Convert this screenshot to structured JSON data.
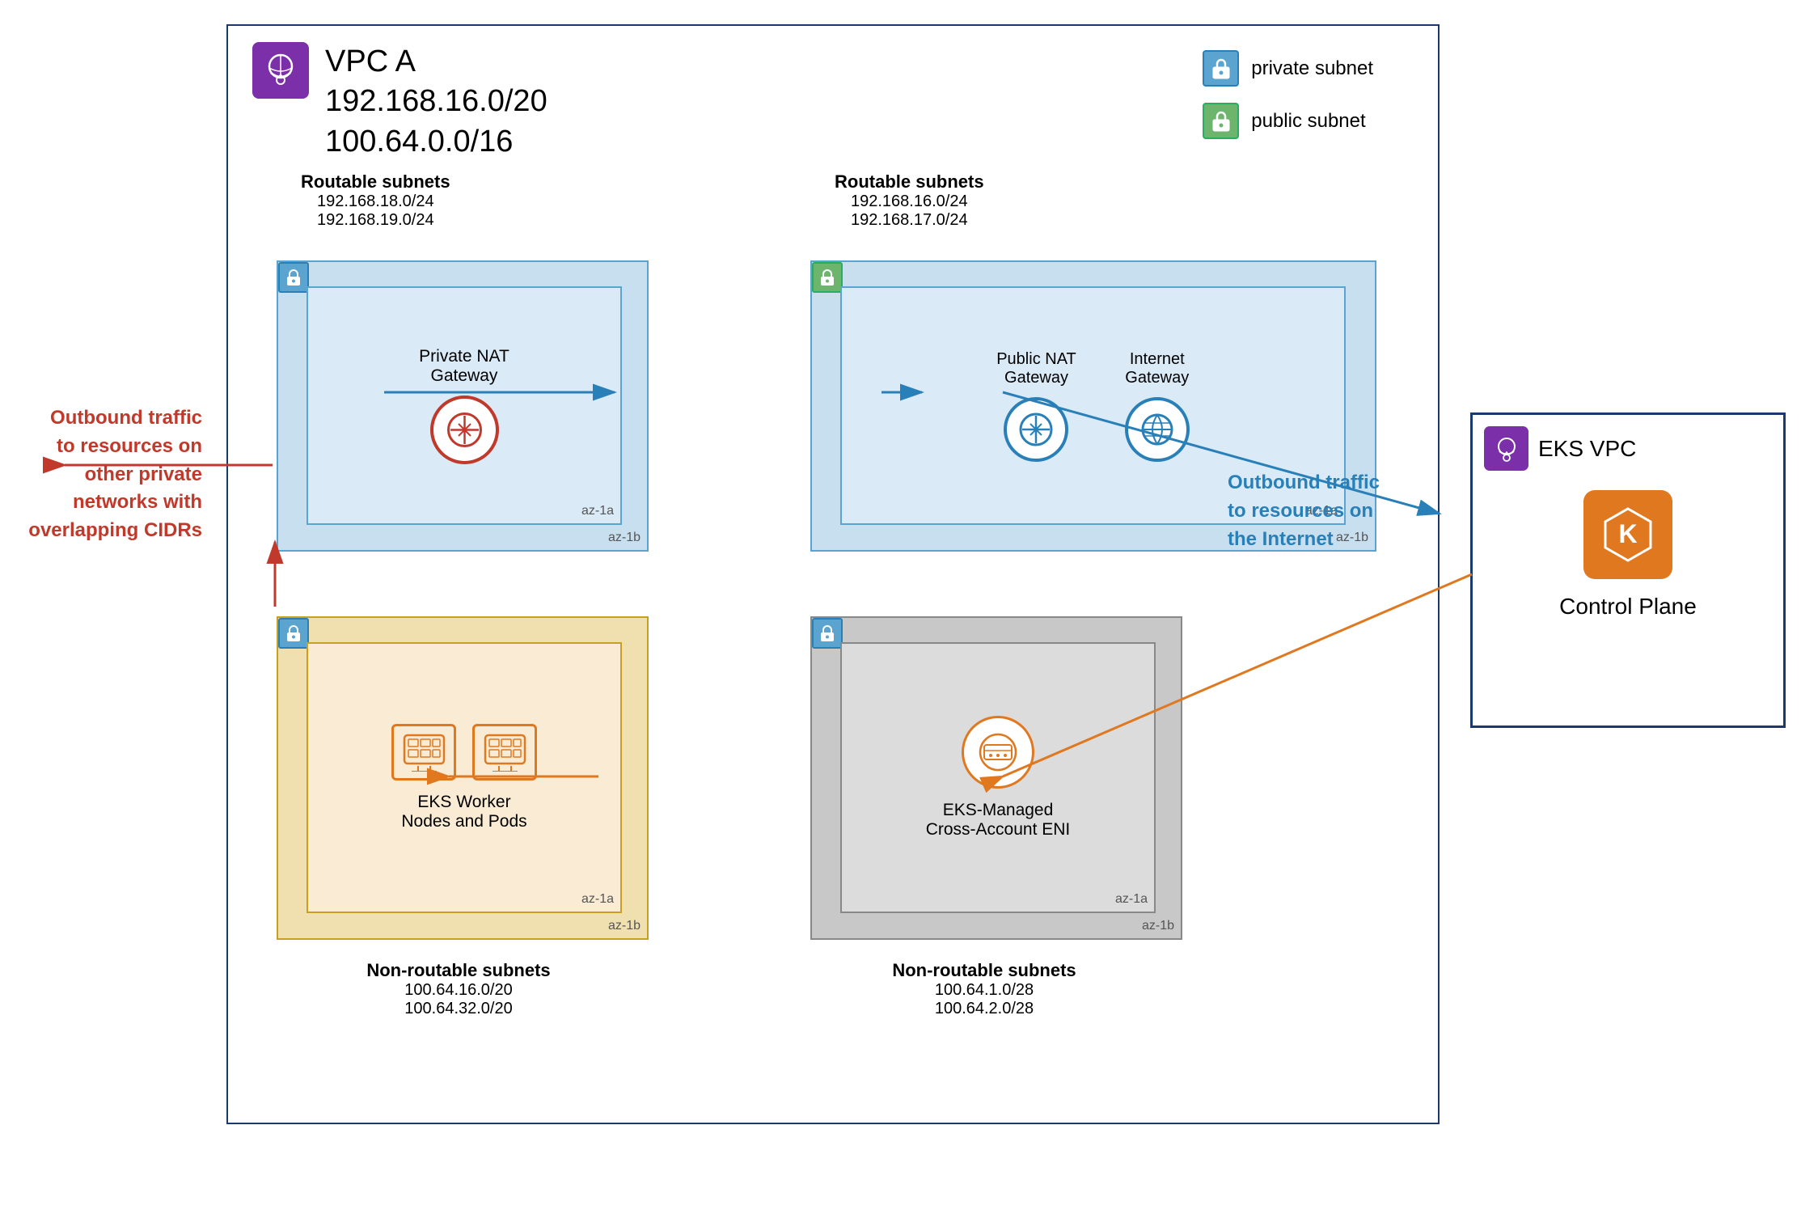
{
  "vpc_a": {
    "title": "VPC A",
    "cidr1": "192.168.16.0/20",
    "cidr2": "100.64.0.0/16"
  },
  "legend": {
    "private_subnet": "private subnet",
    "public_subnet": "public subnet"
  },
  "routable_left": {
    "label": "Routable subnets",
    "cidr1": "192.168.18.0/24",
    "cidr2": "192.168.19.0/24"
  },
  "routable_right": {
    "label": "Routable subnets",
    "cidr1": "192.168.16.0/24",
    "cidr2": "192.168.17.0/24"
  },
  "private_nat": {
    "label": "Private NAT\nGateway",
    "az_inner": "az-1a",
    "az_outer": "az-1b"
  },
  "public_nat": {
    "label": "Public NAT\nGateway",
    "az_inner": "az-1a",
    "az_outer": "az-1b"
  },
  "internet_gw": {
    "label": "Internet\nGateway"
  },
  "eks_workers": {
    "label": "EKS Worker\nNodes and Pods",
    "az_inner": "az-1a",
    "az_outer": "az-1b"
  },
  "cross_account": {
    "label": "EKS-Managed\nCross-Account ENI",
    "az_inner": "az-1a",
    "az_outer": "az-1b"
  },
  "nonroutable_left": {
    "label": "Non-routable subnets",
    "cidr1": "100.64.16.0/20",
    "cidr2": "100.64.32.0/20"
  },
  "nonroutable_right": {
    "label": "Non-routable subnets",
    "cidr1": "100.64.1.0/28",
    "cidr2": "100.64.2.0/28"
  },
  "outbound_left": {
    "line1": "Outbound traffic",
    "line2": "to resources on",
    "line3": "other private",
    "line4": "networks with",
    "line5": "overlapping CIDRs"
  },
  "outbound_right": {
    "line1": "Outbound traffic",
    "line2": "to resources on",
    "line3": "the Internet"
  },
  "eks_vpc": {
    "title": "EKS VPC",
    "cp_label": "Control Plane"
  }
}
